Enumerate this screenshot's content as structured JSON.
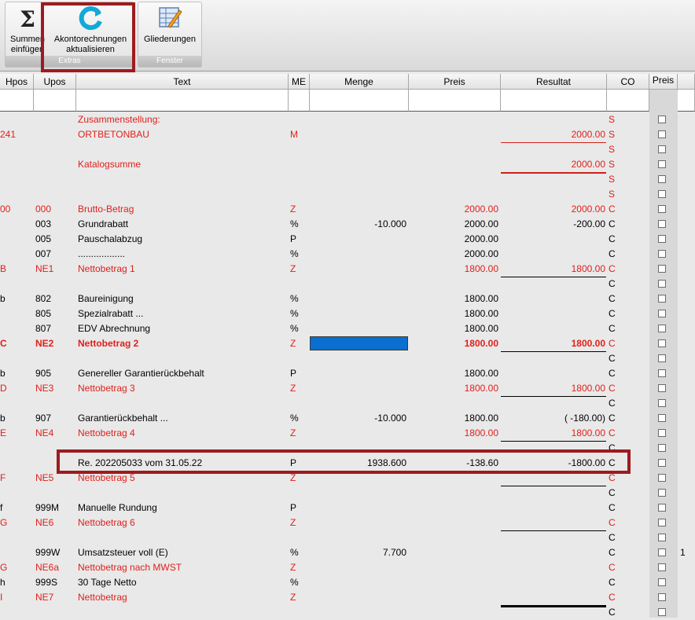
{
  "ribbon": {
    "buttons": [
      {
        "name": "summen-einfuegen-button",
        "label1": "Summen",
        "label2": "einfügen"
      },
      {
        "name": "akontorechnungen-aktualisieren-button",
        "label1": "Akontorechnungen",
        "label2": "aktualisieren"
      },
      {
        "name": "gliederungen-button",
        "label1": "Gliederungen",
        "label2": ""
      }
    ],
    "groups": [
      "Extras",
      "Fenster"
    ]
  },
  "columns": [
    "Hpos",
    "Upos",
    "Text",
    "ME",
    "Menge",
    "Preis",
    "Resultat",
    "CO",
    "Preis"
  ],
  "rows": [
    {
      "hpos": "",
      "upos": "",
      "text": "Zusammenstellung:",
      "me": "",
      "menge": "",
      "preis": "",
      "resultat": "",
      "co": "S",
      "red": true,
      "bold": false
    },
    {
      "hpos": "241",
      "upos": "",
      "text": "ORTBETONBAU",
      "me": "M",
      "menge": "",
      "preis": "",
      "resultat": "2000.00",
      "co": "S",
      "red": true,
      "bold": false
    },
    {
      "hpos": "",
      "upos": "",
      "text": "",
      "me": "",
      "menge": "",
      "preis": "",
      "resultat": "",
      "co": "S",
      "red": true,
      "bold": false
    },
    {
      "hpos": "",
      "upos": "",
      "text": "Katalogsumme",
      "me": "",
      "menge": "",
      "preis": "",
      "resultat": "2000.00",
      "co": "S",
      "red": true,
      "bold": false
    },
    {
      "hpos": "",
      "upos": "",
      "text": "",
      "me": "",
      "menge": "",
      "preis": "",
      "resultat": "",
      "co": "S",
      "red": true,
      "bold": false
    },
    {
      "hpos": "",
      "upos": "",
      "text": "",
      "me": "",
      "menge": "",
      "preis": "",
      "resultat": "",
      "co": "S",
      "red": true,
      "bold": false
    },
    {
      "hpos": "00",
      "upos": "000",
      "text": "Brutto-Betrag",
      "me": "Z",
      "menge": "",
      "preis": "2000.00",
      "resultat": "2000.00",
      "co": "C",
      "red": true,
      "bold": false
    },
    {
      "hpos": "",
      "upos": "003",
      "text": "Grundrabatt",
      "me": "%",
      "menge": "-10.000",
      "preis": "2000.00",
      "resultat": "-200.00",
      "co": "C",
      "red": false,
      "bold": false
    },
    {
      "hpos": "",
      "upos": "005",
      "text": "Pauschalabzug",
      "me": "P",
      "menge": "",
      "preis": "2000.00",
      "resultat": "",
      "co": "C",
      "red": false,
      "bold": false
    },
    {
      "hpos": "",
      "upos": "007",
      "text": "..................",
      "me": "%",
      "menge": "",
      "preis": "2000.00",
      "resultat": "",
      "co": "C",
      "red": false,
      "bold": false
    },
    {
      "hpos": "B",
      "upos": "NE1",
      "text": "Nettobetrag 1",
      "me": "Z",
      "menge": "",
      "preis": "1800.00",
      "resultat": "1800.00",
      "co": "C",
      "red": true,
      "bold": false
    },
    {
      "hpos": "",
      "upos": "",
      "text": "",
      "me": "",
      "menge": "",
      "preis": "",
      "resultat": "",
      "co": "C",
      "red": false,
      "bold": false
    },
    {
      "hpos": "b",
      "upos": "802",
      "text": "Baureinigung",
      "me": "%",
      "menge": "",
      "preis": "1800.00",
      "resultat": "",
      "co": "C",
      "red": false,
      "bold": false
    },
    {
      "hpos": "",
      "upos": "805",
      "text": "Spezialrabatt ...",
      "me": "%",
      "menge": "",
      "preis": "1800.00",
      "resultat": "",
      "co": "C",
      "red": false,
      "bold": false
    },
    {
      "hpos": "",
      "upos": "807",
      "text": "EDV Abrechnung",
      "me": "%",
      "menge": "",
      "preis": "1800.00",
      "resultat": "",
      "co": "C",
      "red": false,
      "bold": false
    },
    {
      "hpos": "C",
      "upos": "NE2",
      "text": "Nettobetrag 2",
      "me": "Z",
      "menge": "",
      "preis": "1800.00",
      "resultat": "1800.00",
      "co": "C",
      "red": true,
      "bold": true
    },
    {
      "hpos": "",
      "upos": "",
      "text": "",
      "me": "",
      "menge": "",
      "preis": "",
      "resultat": "",
      "co": "C",
      "red": false,
      "bold": false
    },
    {
      "hpos": "b",
      "upos": "905",
      "text": "Genereller Garantierückbehalt",
      "me": "P",
      "menge": "",
      "preis": "1800.00",
      "resultat": "",
      "co": "C",
      "red": false,
      "bold": false
    },
    {
      "hpos": "D",
      "upos": "NE3",
      "text": "Nettobetrag 3",
      "me": "Z",
      "menge": "",
      "preis": "1800.00",
      "resultat": "1800.00",
      "co": "C",
      "red": true,
      "bold": false
    },
    {
      "hpos": "",
      "upos": "",
      "text": "",
      "me": "",
      "menge": "",
      "preis": "",
      "resultat": "",
      "co": "C",
      "red": false,
      "bold": false
    },
    {
      "hpos": "b",
      "upos": "907",
      "text": "Garantierückbehalt ...",
      "me": "%",
      "menge": "-10.000",
      "preis": "1800.00",
      "resultat": "(      -180.00)",
      "co": "C",
      "red": false,
      "bold": false
    },
    {
      "hpos": "E",
      "upos": "NE4",
      "text": "Nettobetrag 4",
      "me": "Z",
      "menge": "",
      "preis": "1800.00",
      "resultat": "1800.00",
      "co": "C",
      "red": true,
      "bold": false
    },
    {
      "hpos": "",
      "upos": "",
      "text": "",
      "me": "",
      "menge": "",
      "preis": "",
      "resultat": "",
      "co": "C",
      "red": false,
      "bold": false
    },
    {
      "hpos": "",
      "upos": "",
      "text": "Re. 202205033 vom 31.05.22",
      "me": "P",
      "menge": "1938.600",
      "preis": "-138.60",
      "resultat": "-1800.00",
      "co": "C",
      "red": false,
      "bold": false
    },
    {
      "hpos": "F",
      "upos": "NE5",
      "text": "Nettobetrag 5",
      "me": "Z",
      "menge": "",
      "preis": "",
      "resultat": "",
      "co": "C",
      "red": true,
      "bold": false
    },
    {
      "hpos": "",
      "upos": "",
      "text": "",
      "me": "",
      "menge": "",
      "preis": "",
      "resultat": "",
      "co": "C",
      "red": false,
      "bold": false
    },
    {
      "hpos": "f",
      "upos": "999M",
      "text": "Manuelle Rundung",
      "me": "P",
      "menge": "",
      "preis": "",
      "resultat": "",
      "co": "C",
      "red": false,
      "bold": false
    },
    {
      "hpos": "G",
      "upos": "NE6",
      "text": "Nettobetrag 6",
      "me": "Z",
      "menge": "",
      "preis": "",
      "resultat": "",
      "co": "C",
      "red": true,
      "bold": false
    },
    {
      "hpos": "",
      "upos": "",
      "text": "",
      "me": "",
      "menge": "",
      "preis": "",
      "resultat": "",
      "co": "C",
      "red": false,
      "bold": false
    },
    {
      "hpos": "",
      "upos": "999W",
      "text": "Umsatzsteuer voll (E)",
      "me": "%",
      "menge": "7.700",
      "preis": "",
      "resultat": "",
      "co": "C",
      "red": false,
      "bold": false,
      "extra": "1"
    },
    {
      "hpos": "G",
      "upos": "NE6a",
      "text": "Nettobetrag nach MWST",
      "me": "Z",
      "menge": "",
      "preis": "",
      "resultat": "",
      "co": "C",
      "red": true,
      "bold": false
    },
    {
      "hpos": "h",
      "upos": "999S",
      "text": "30 Tage Netto",
      "me": "%",
      "menge": "",
      "preis": "",
      "resultat": "",
      "co": "C",
      "red": false,
      "bold": false
    },
    {
      "hpos": "I",
      "upos": "NE7",
      "text": "Nettobetrag",
      "me": "Z",
      "menge": "",
      "preis": "",
      "resultat": "",
      "co": "C",
      "red": true,
      "bold": false
    },
    {
      "hpos": "",
      "upos": "",
      "text": "",
      "me": "",
      "menge": "",
      "preis": "",
      "resultat": "",
      "co": "C",
      "red": false,
      "bold": false
    }
  ]
}
